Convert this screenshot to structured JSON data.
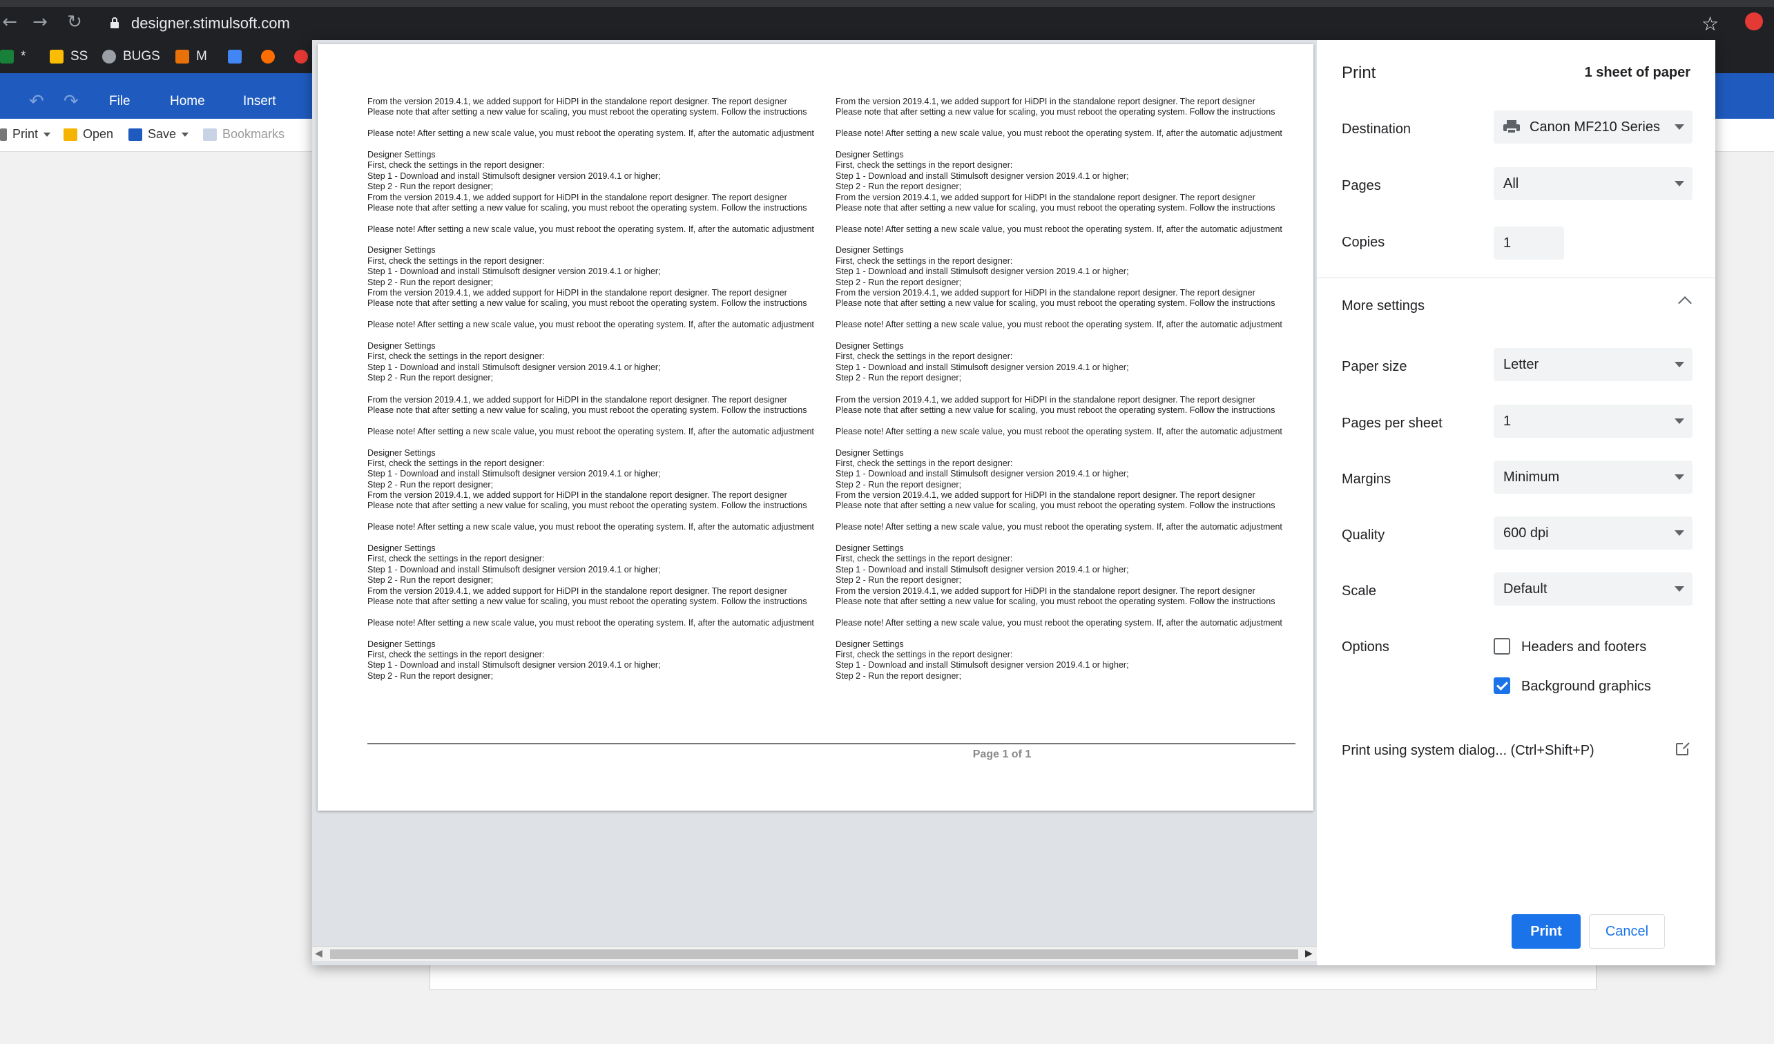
{
  "browser": {
    "url": "designer.stimulsoft.com",
    "bookmarks": [
      {
        "label": "*",
        "color": "#188038"
      },
      {
        "label": "SS",
        "color": "#fbbc04"
      },
      {
        "label": "BUGS",
        "color": "#9aa0a6"
      },
      {
        "label": "M",
        "color": "#e8710a"
      },
      {
        "label": "",
        "color": "#4285f4"
      },
      {
        "label": "",
        "color": "#ff6d00"
      },
      {
        "label": "",
        "color": "#e53935"
      }
    ]
  },
  "app": {
    "tabs": [
      "File",
      "Home",
      "Insert"
    ],
    "toolbar": {
      "print": "Print",
      "open": "Open",
      "save": "Save",
      "bookmarks": "Bookmarks"
    }
  },
  "preview": {
    "column_left_lines": [
      "From the version 2019.4.1, we added support for HiDPI in the standalone report designer. The report designer",
      "Please note that after setting a new value for scaling, you must reboot the operating system. Follow the instructions",
      "",
      "Please note! After setting a new scale value, you must reboot the operating system. If, after the automatic adjustment",
      "",
      "Designer Settings",
      "First, check the settings in the report designer:",
      "Step 1 - Download and install Stimulsoft designer version 2019.4.1 or higher;",
      "Step 2 - Run the report designer;"
    ],
    "column_right_lines": [
      "From the version 2019.4.1, we added support for HiDPI in the standalone report designer. The report designer",
      "Please note that after setting a new value for scaling, you must reboot the operating system. Follow the instructions",
      "",
      "Please note! After setting a new scale value, you must reboot the operating system. If, after the automatic adjustment",
      "",
      "Designer Settings",
      "First, check the settings in the report designer:",
      "Step 1 - Download and install Stimulsoft designer version 2019.4.1 or higher;",
      "Step 2 - Run the report designer;"
    ],
    "page_footer": "Page 1 of 1"
  },
  "print": {
    "title": "Print",
    "sheets": "1 sheet of paper",
    "destination_label": "Destination",
    "destination_value": "Canon MF210 Series",
    "pages_label": "Pages",
    "pages_value": "All",
    "copies_label": "Copies",
    "copies_value": "1",
    "more_settings": "More settings",
    "paper_size_label": "Paper size",
    "paper_size_value": "Letter",
    "pages_per_sheet_label": "Pages per sheet",
    "pages_per_sheet_value": "1",
    "margins_label": "Margins",
    "margins_value": "Minimum",
    "quality_label": "Quality",
    "quality_value": "600 dpi",
    "scale_label": "Scale",
    "scale_value": "Default",
    "options_label": "Options",
    "headers_footers": "Headers and footers",
    "headers_footers_checked": false,
    "background_graphics": "Background graphics",
    "background_graphics_checked": true,
    "system_dialog": "Print using system dialog... (Ctrl+Shift+P)",
    "print_button": "Print",
    "cancel_button": "Cancel"
  },
  "colors": {
    "accent": "#1a73e8",
    "ribbon": "#1f5bbf",
    "chrome_dark": "#202124"
  }
}
